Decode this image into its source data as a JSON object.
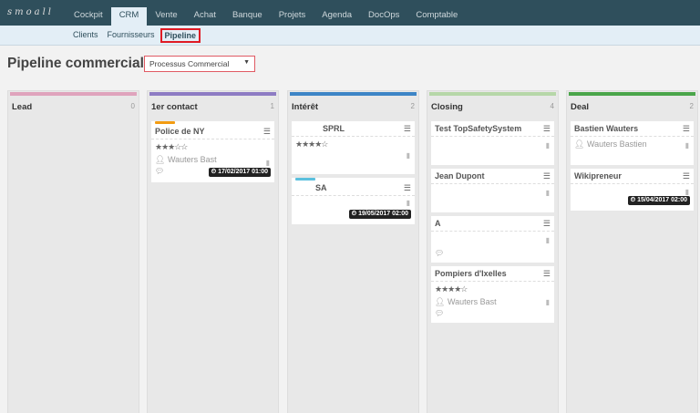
{
  "app": {
    "logo": "smoall"
  },
  "nav": [
    "Cockpit",
    "CRM",
    "Vente",
    "Achat",
    "Banque",
    "Projets",
    "Agenda",
    "DocOps",
    "Comptable"
  ],
  "subnav": [
    "Clients",
    "Fournisseurs",
    "Pipeline"
  ],
  "page": {
    "title": "Pipeline commercial",
    "process_select": "Processus Commercial"
  },
  "colors": {
    "lead": "#dfa3bc",
    "contact": "#8e7cc3",
    "interet": "#3d85c6",
    "closing": "#b6d7a8",
    "deal": "#4aa54a",
    "orange": "#f39c12",
    "cyan": "#5bc0de"
  },
  "columns": [
    {
      "name": "Lead",
      "count": "0"
    },
    {
      "name": "1er contact",
      "count": "1"
    },
    {
      "name": "Intérêt",
      "count": "2"
    },
    {
      "name": "Closing",
      "count": "4"
    },
    {
      "name": "Deal",
      "count": "2"
    }
  ],
  "cards": {
    "c1": {
      "title": "Police de NY",
      "stars": "★★★☆☆",
      "person": "Wauters Bast",
      "date": "17/02/2017 01:00"
    },
    "i1": {
      "title": "SPRL",
      "stars": "★★★★☆"
    },
    "i2": {
      "title": "SA",
      "date": "19/05/2017 02:00"
    },
    "cl1": {
      "title": "Test TopSafetySystem"
    },
    "cl2": {
      "title": "Jean Dupont"
    },
    "cl3": {
      "title": "A"
    },
    "cl4": {
      "title": "Pompiers d'Ixelles",
      "stars": "★★★★☆",
      "person": "Wauters Bast"
    },
    "d1": {
      "title": "Bastien Wauters",
      "person": "Wauters Bastien"
    },
    "d2": {
      "title": "Wikipreneur",
      "date": "15/04/2017 02:00"
    }
  }
}
